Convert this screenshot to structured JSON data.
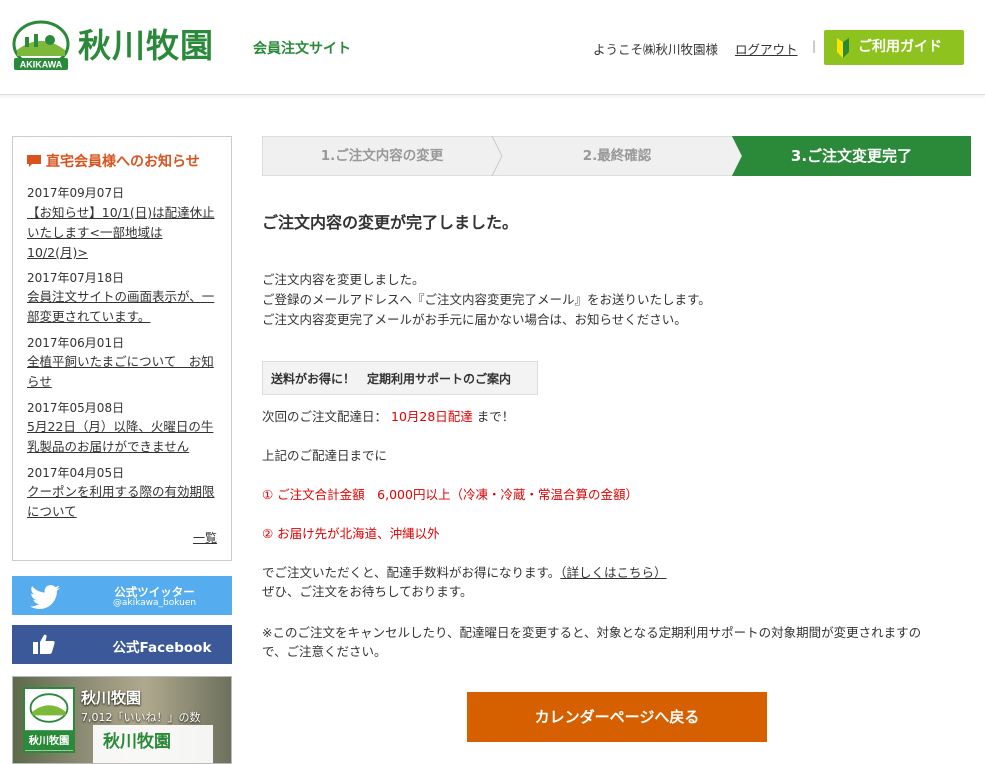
{
  "header": {
    "logo_badge": "AKIKAWA",
    "logo_text": "秋川牧園",
    "site_label": "会員注文サイト",
    "welcome": "ようこそ㈱秋川牧園様",
    "logout": "ログアウト",
    "separator": "|",
    "guide_button": "ご利用ガイド"
  },
  "news": {
    "title": "直宅会員様へのお知らせ",
    "items": [
      {
        "date": "2017年09月07日",
        "text": "【お知らせ】10/1(日)は配達休止いたします<一部地域は10/2(月)>"
      },
      {
        "date": "2017年07月18日",
        "text": "会員注文サイトの画面表示が、一部変更されています。"
      },
      {
        "date": "2017年06月01日",
        "text": "全植平飼いたまごについて　お知らせ"
      },
      {
        "date": "2017年05月08日",
        "text": "5月22日（月）以降、火曜日の牛乳製品のお届けができません"
      },
      {
        "date": "2017年04月05日",
        "text": "クーポンを利用する際の有効期限について"
      }
    ],
    "more": "一覧"
  },
  "twitter": {
    "name": "公式ツイッター",
    "handle": "@akikawa_bokuen"
  },
  "facebook": {
    "label": "公式Facebook"
  },
  "fb_widget": {
    "page_name": "秋川牧園",
    "likes": "7,012「いいね！」の数",
    "card_text": "秋川牧園",
    "logo_text": "秋川牧園"
  },
  "steps": [
    {
      "label": "1.ご注文内容の変更",
      "active": false
    },
    {
      "label": "2.最終確認",
      "active": false
    },
    {
      "label": "3.ご注文変更完了",
      "active": true
    }
  ],
  "main": {
    "title": "ご注文内容の変更が完了しました。",
    "para1": [
      "ご注文内容を変更しました。",
      "ご登録のメールアドレスへ『ご注文内容変更完了メール』をお送りいたします。",
      "ご注文内容変更完了メールがお手元に届かない場合は、お知らせください。"
    ],
    "promo_box": "送料がお得に！　定期利用サポートのご案内",
    "next_delivery_label": "次回のご注文配達日：",
    "next_delivery_date": "10月28日配達",
    "next_delivery_suffix": "まで！",
    "until_text": "上記のご配達日までに",
    "condition1": "① ご注文合計金額　6,000円以上（冷凍・冷蔵・常温合算の金額）",
    "condition2": "② お届け先が北海道、沖縄以外",
    "benefit_text": "でご注文いただくと、配達手数料がお得になります。",
    "benefit_link": "（詳しくはこちら）",
    "closing": "ぜひ、ご注文をお待ちしております。",
    "note_line1": "※このご注文をキャンセルしたり、配達曜日を変更すると、対象となる定期利用サポートの対象期間が変更されますの",
    "note_line2": "で、ご注意ください。",
    "back_button": "カレンダーページへ戻る"
  },
  "colors": {
    "brand_green": "#2a8a3a",
    "guide_green": "#8dc21f",
    "accent_orange": "#d65f00",
    "alert_red": "#e00000",
    "step_active": "#2a8a3a"
  }
}
